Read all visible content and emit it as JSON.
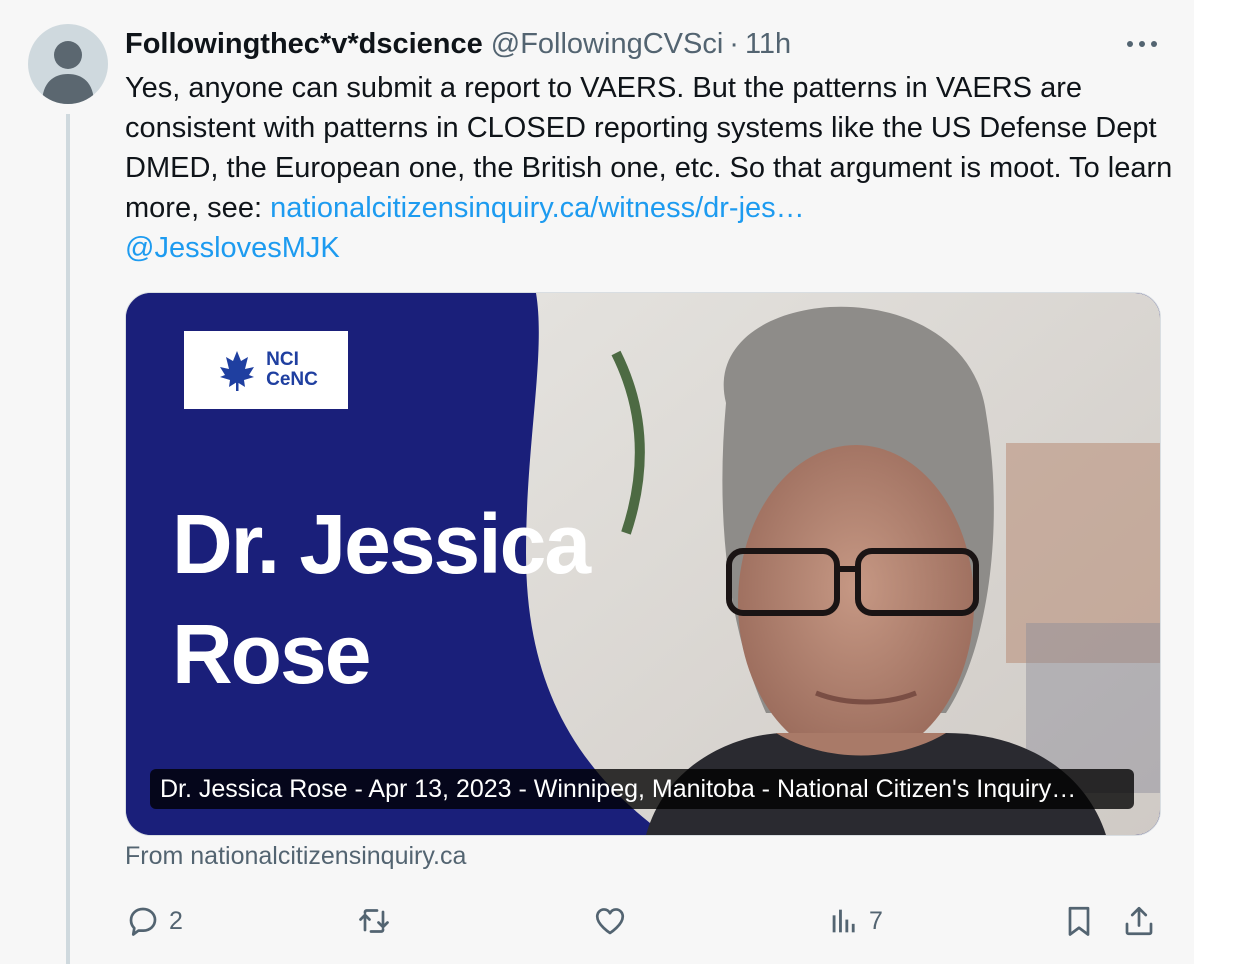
{
  "tweet": {
    "author_name": "Followingthec*v*dscience",
    "author_handle": "@FollowingCVSci",
    "separator": "·",
    "time": "11h",
    "text_main": "Yes, anyone can submit a report to VAERS. But the patterns in VAERS are consistent with patterns in CLOSED reporting systems like the US Defense Dept DMED, the European one, the British one, etc. So that argument is moot. To learn more, see: ",
    "link_text": "nationalcitizensinquiry.ca/witness/dr-jes…",
    "mention": "@JesslovesMJK"
  },
  "card": {
    "logo_line1": "NCI",
    "logo_line2": "CeNC",
    "title_line1": "Dr. Jessica",
    "title_line2": "Rose",
    "caption": "Dr. Jessica Rose - Apr 13, 2023 - Winnipeg, Manitoba - National Citizen's Inquiry…",
    "source": "From nationalcitizensinquiry.ca"
  },
  "actions": {
    "reply_count": "2",
    "views_count": "7"
  },
  "colors": {
    "link": "#1d9bf0",
    "card_blue": "#1a1f7a",
    "secondary_text": "#536471"
  },
  "icons": [
    "more-icon",
    "reply-icon",
    "retweet-icon",
    "like-icon",
    "views-icon",
    "bookmark-icon",
    "share-icon"
  ]
}
